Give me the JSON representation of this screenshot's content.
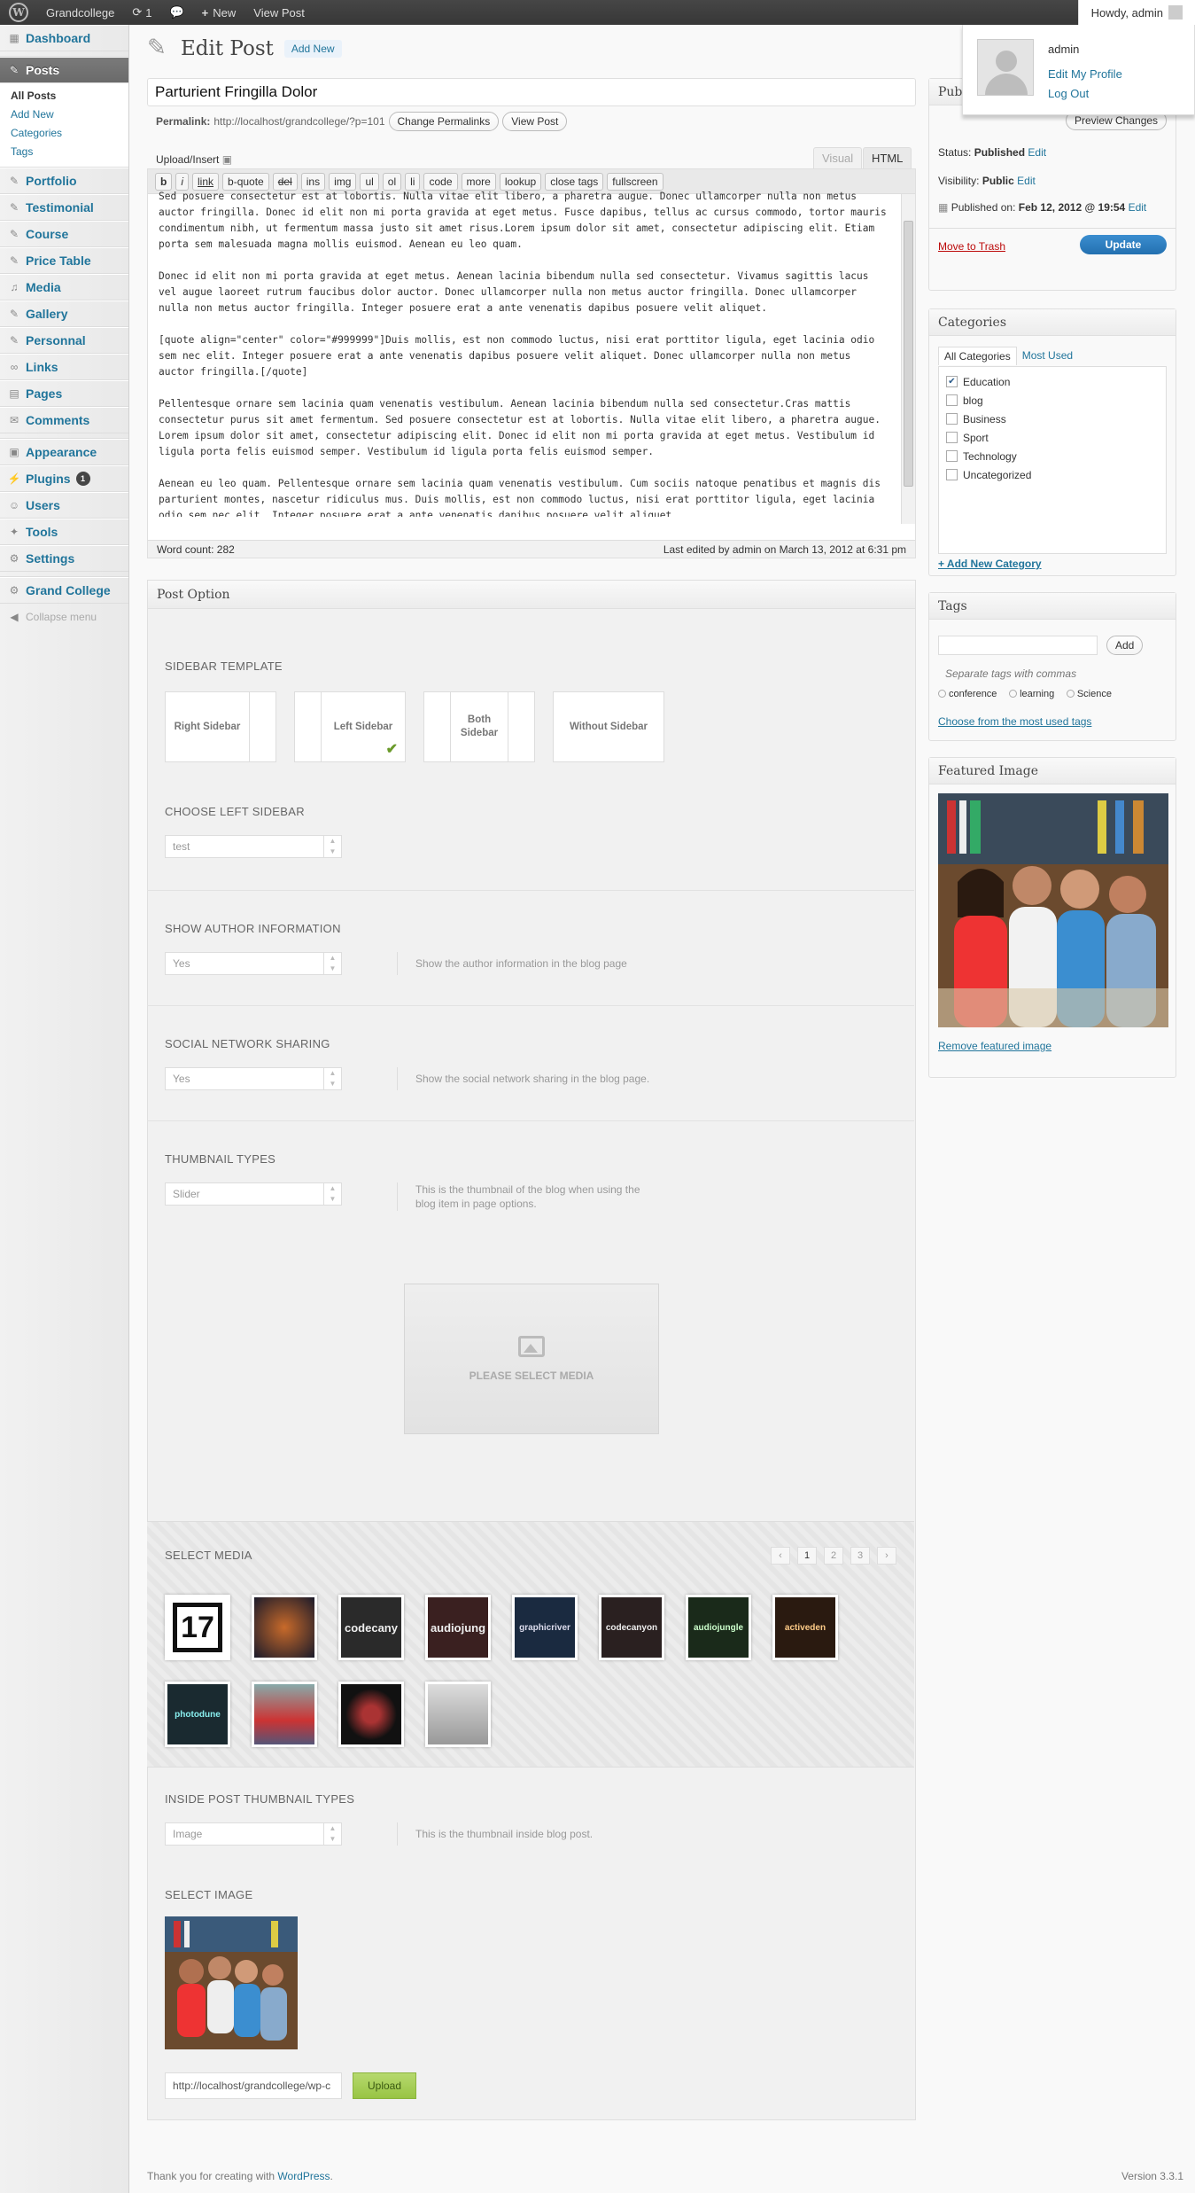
{
  "adminbar": {
    "site_name": "Grandcollege",
    "updates_count": "1",
    "new_label": "New",
    "view_post_label": "View Post",
    "howdy": "Howdy, admin"
  },
  "profile": {
    "username": "admin",
    "edit_profile": "Edit My Profile",
    "logout": "Log Out"
  },
  "menu": {
    "dashboard": "Dashboard",
    "posts": "Posts",
    "posts_sub": [
      "All Posts",
      "Add New",
      "Categories",
      "Tags"
    ],
    "portfolio": "Portfolio",
    "testimonial": "Testimonial",
    "course": "Course",
    "price_table": "Price Table",
    "media": "Media",
    "gallery": "Gallery",
    "personnal": "Personnal",
    "links": "Links",
    "pages": "Pages",
    "comments": "Comments",
    "appearance": "Appearance",
    "plugins": "Plugins",
    "plugins_badge": "1",
    "users": "Users",
    "tools": "Tools",
    "settings": "Settings",
    "grand_college": "Grand College",
    "collapse": "Collapse menu"
  },
  "page": {
    "title": "Edit Post",
    "add_new": "Add New",
    "post_title": "Parturient Fringilla Dolor",
    "permalink_label": "Permalink:",
    "permalink_url": "http://localhost/grandcollege/?p=101",
    "change_permalinks": "Change Permalinks",
    "view_post": "View Post",
    "upload_insert": "Upload/Insert",
    "tab_visual": "Visual",
    "tab_html": "HTML"
  },
  "quicktags": [
    "b",
    "i",
    "link",
    "b-quote",
    "del",
    "ins",
    "img",
    "ul",
    "ol",
    "li",
    "code",
    "more",
    "lookup",
    "close tags",
    "fullscreen"
  ],
  "editor": {
    "content": "Sed posuere consectetur est at lobortis. Nulla vitae elit libero, a pharetra augue. Donec ullamcorper nulla non metus auctor fringilla. Donec id elit non mi porta gravida at eget metus. Fusce dapibus, tellus ac cursus commodo, tortor mauris condimentum nibh, ut fermentum massa justo sit amet risus.Lorem ipsum dolor sit amet, consectetur adipiscing elit. Etiam porta sem malesuada magna mollis euismod. Aenean eu leo quam.\n\nDonec id elit non mi porta gravida at eget metus. Aenean lacinia bibendum nulla sed consectetur. Vivamus sagittis lacus vel augue laoreet rutrum faucibus dolor auctor. Donec ullamcorper nulla non metus auctor fringilla. Donec ullamcorper nulla non metus auctor fringilla. Integer posuere erat a ante venenatis dapibus posuere velit aliquet.\n\n[quote align=\"center\" color=\"#999999\"]Duis mollis, est non commodo luctus, nisi erat porttitor ligula, eget lacinia odio sem nec elit. Integer posuere erat a ante venenatis dapibus posuere velit aliquet. Donec ullamcorper nulla non metus auctor fringilla.[/quote]\n\nPellentesque ornare sem lacinia quam venenatis vestibulum. Aenean lacinia bibendum nulla sed consectetur.Cras mattis consectetur purus sit amet fermentum. Sed posuere consectetur est at lobortis. Nulla vitae elit libero, a pharetra augue. Lorem ipsum dolor sit amet, consectetur adipiscing elit. Donec id elit non mi porta gravida at eget metus. Vestibulum id ligula porta felis euismod semper. Vestibulum id ligula porta felis euismod semper.\n\nAenean eu leo quam. Pellentesque ornare sem lacinia quam venenatis vestibulum. Cum sociis natoque penatibus et magnis dis parturient montes, nascetur ridiculus mus. Duis mollis, est non commodo luctus, nisi erat porttitor ligula, eget lacinia odio sem nec elit. Integer posuere erat a ante venenatis dapibus posuere velit aliquet.",
    "word_count": "Word count: 282",
    "last_edited": "Last edited by admin on March 13, 2012 at 6:31 pm"
  },
  "post_option": {
    "title": "Post Option",
    "sidebar_template": "SIDEBAR TEMPLATE",
    "sidebar_options": [
      "Right Sidebar",
      "Left Sidebar",
      "Both Sidebar",
      "Without Sidebar"
    ],
    "choose_left_sidebar": "CHOOSE LEFT SIDEBAR",
    "left_sidebar_value": "test",
    "show_author": "SHOW AUTHOR INFORMATION",
    "show_author_value": "Yes",
    "show_author_desc": "Show the author information in the blog page",
    "social_sharing": "SOCIAL NETWORK SHARING",
    "social_sharing_value": "Yes",
    "social_sharing_desc": "Show the social network sharing in the blog page.",
    "thumbnail_types": "THUMBNAIL TYPES",
    "thumbnail_value": "Slider",
    "thumbnail_desc": "This is the thumbnail of the blog when using the blog item in page options.",
    "please_select_media": "PLEASE SELECT MEDIA",
    "select_media": "SELECT MEDIA",
    "pager": [
      "‹",
      "1",
      "2",
      "3",
      "›"
    ],
    "media_items": [
      "",
      "",
      "codecany",
      "audiojung",
      "graphicriver",
      "codecanyon",
      "audiojungle",
      "activeden",
      "photodune",
      "",
      "",
      ""
    ],
    "inside_thumbnail": "INSIDE POST THUMBNAIL TYPES",
    "inside_value": "Image",
    "inside_desc": "This is the thumbnail inside blog post.",
    "select_image": "SELECT IMAGE",
    "image_url": "http://localhost/grandcollege/wp-c",
    "upload": "Upload"
  },
  "publish": {
    "title": "Publ",
    "preview_changes": "Preview Changes",
    "status_label": "Status:",
    "status_value": "Published",
    "visibility_label": "Visibility:",
    "visibility_value": "Public",
    "published_on_label": "Published on:",
    "published_on_value": "Feb 12, 2012 @ 19:54",
    "edit": "Edit",
    "move_trash": "Move to Trash",
    "update": "Update"
  },
  "categories": {
    "title": "Categories",
    "tab_all": "All Categories",
    "tab_most": "Most Used",
    "items": [
      {
        "name": "Education",
        "checked": true
      },
      {
        "name": "blog",
        "checked": false
      },
      {
        "name": "Business",
        "checked": false
      },
      {
        "name": "Sport",
        "checked": false
      },
      {
        "name": "Technology",
        "checked": false
      },
      {
        "name": "Uncategorized",
        "checked": false
      }
    ],
    "add_new": "+ Add New Category"
  },
  "tags": {
    "title": "Tags",
    "add_button": "Add",
    "hint": "Separate tags with commas",
    "tag_list": [
      "conference",
      "learning",
      "Science"
    ],
    "choose_most_used": "Choose from the most used tags"
  },
  "featured": {
    "title": "Featured Image",
    "remove": "Remove featured image"
  },
  "footer": {
    "thanks_prefix": "Thank you for creating with ",
    "thanks_link": "WordPress",
    "thanks_suffix": ".",
    "version": "Version 3.3.1"
  },
  "colors": {
    "link": "#21759b",
    "update_button": "#2a7fbf",
    "trash": "#bc0b0b",
    "upload_button": "#9cc84a"
  }
}
